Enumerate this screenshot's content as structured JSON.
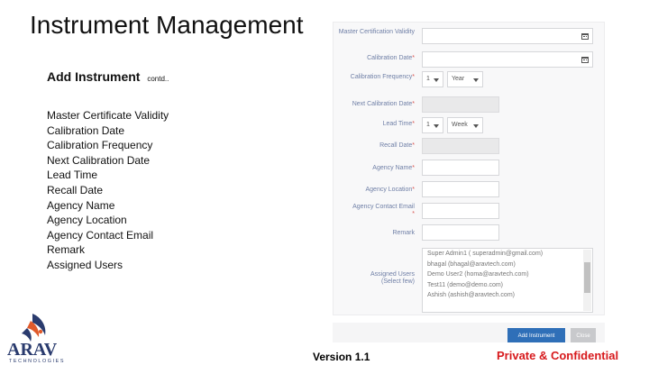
{
  "slide": {
    "title": "Instrument Management",
    "subtitle": "Add Instrument",
    "subtitle_suffix": "contd..",
    "field_list": [
      "Master Certificate Validity",
      "Calibration Date",
      "Calibration Frequency",
      "Next Calibration Date",
      "Lead Time",
      "Recall Date",
      "Agency Name",
      "Agency Location",
      "Agency Contact Email",
      "Remark",
      "Assigned Users"
    ]
  },
  "form": {
    "master_cert_label": "Master Certification Validity",
    "calibration_date_label": "Calibration Date",
    "calibration_freq_label": "Calibration Frequency",
    "calibration_freq_number": "1",
    "calibration_freq_unit": "Year",
    "next_calibration_label": "Next Calibration Date",
    "lead_time_label": "Lead Time",
    "lead_time_number": "1",
    "lead_time_unit": "Week",
    "recall_date_label": "Recall Date",
    "agency_name_label": "Agency Name",
    "agency_location_label": "Agency Location",
    "agency_email_label": "Agency Contact Email",
    "remark_label": "Remark",
    "assigned_users_label": "Assigned Users",
    "assigned_users_hint": "(Select few)",
    "required_mark": "*",
    "users": [
      "Super Admin1 ( superadmin@gmail.com)",
      "bhagal (bhagal@aravtech.com)",
      "Demo User2 (homa@aravtech.com)",
      "Test11 (demo@demo.com)",
      "Ashish (ashish@aravtech.com)"
    ],
    "add_button": "Add Instrument",
    "close_button": "Close"
  },
  "footer": {
    "logo_text": "ARAV",
    "logo_subtext": "TECHNOLOGIES",
    "version": "Version 1.1",
    "confidential": "Private & Confidential"
  },
  "colors": {
    "primary_button": "#2f6fb8",
    "label": "#6f7fa6",
    "required": "#d9534f",
    "confidential": "#d7191c",
    "logo_navy": "#2a3b6e",
    "logo_orange": "#e05a2b"
  }
}
